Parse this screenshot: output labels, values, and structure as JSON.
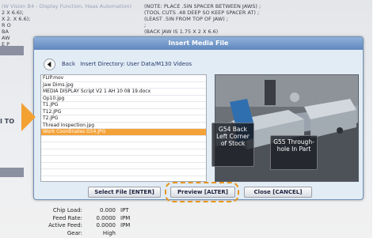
{
  "background": {
    "left_top_lines": [
      "(W Vision B4 - Display Function, Haas Automation)",
      "2 X 6.6);",
      "X 2. X 6.6);",
      "",
      "R O",
      "BA",
      "AW",
      "E P"
    ],
    "right_top_lines": [
      "(NOTE: PLACE .5IN SPACER BETWEEN JAWS) ;",
      "(TOOL CUTS .48 DEEP SO KEEP SPACER AT) ;",
      "(LEAST .5IN FROM TOP OF JAW) ;",
      ";",
      "(BACK JAW IS 1.75 X 2 X 6.6)"
    ],
    "left_mid_lines": [
      "",
      "",
      "I TO"
    ]
  },
  "dialog": {
    "title": "Insert Media File",
    "back_label": "Back",
    "directory_label": "Insert Directory: User Data/M130 Videos",
    "files": [
      {
        "name": "FLIP.mov",
        "selected": false
      },
      {
        "name": "Jaw Dims.jpg",
        "selected": false
      },
      {
        "name": "MEDIA DISPLAY Script V2 1 AH 10 08 19.docx",
        "selected": false
      },
      {
        "name": "Op10.jpg",
        "selected": false
      },
      {
        "name": "T1.JPG",
        "selected": false
      },
      {
        "name": "T12.JPG",
        "selected": false
      },
      {
        "name": "T2.JPG",
        "selected": false
      },
      {
        "name": "Thread Inspection.jpg",
        "selected": false
      },
      {
        "name": "Work Coordinates G54.JPG",
        "selected": true
      },
      {
        "name": "",
        "selected": false
      },
      {
        "name": "",
        "selected": false
      },
      {
        "name": "",
        "selected": false
      },
      {
        "name": "",
        "selected": false
      },
      {
        "name": "",
        "selected": false
      },
      {
        "name": "",
        "selected": false
      }
    ],
    "preview": {
      "callout1": "G54 Back Left Corner of Stock",
      "callout2": "G55 Through-hole In Part"
    },
    "buttons": {
      "select": "Select File [ENTER]",
      "preview": "Preview [ALTER]",
      "close": "Close [CANCEL]"
    }
  },
  "stats": [
    {
      "label": "Chip Load:",
      "value": "0.000",
      "unit": "IPT"
    },
    {
      "label": "Feed Rate:",
      "value": "0.0000",
      "unit": "IPM"
    },
    {
      "label": "Active Feed:",
      "value": "0.0000",
      "unit": "IPM"
    },
    {
      "label": "Gear:",
      "value": "High",
      "unit": ""
    }
  ],
  "colors": {
    "selection": "#f4a238",
    "highlight": "#e6951e",
    "title_bar": "#5f87be"
  }
}
